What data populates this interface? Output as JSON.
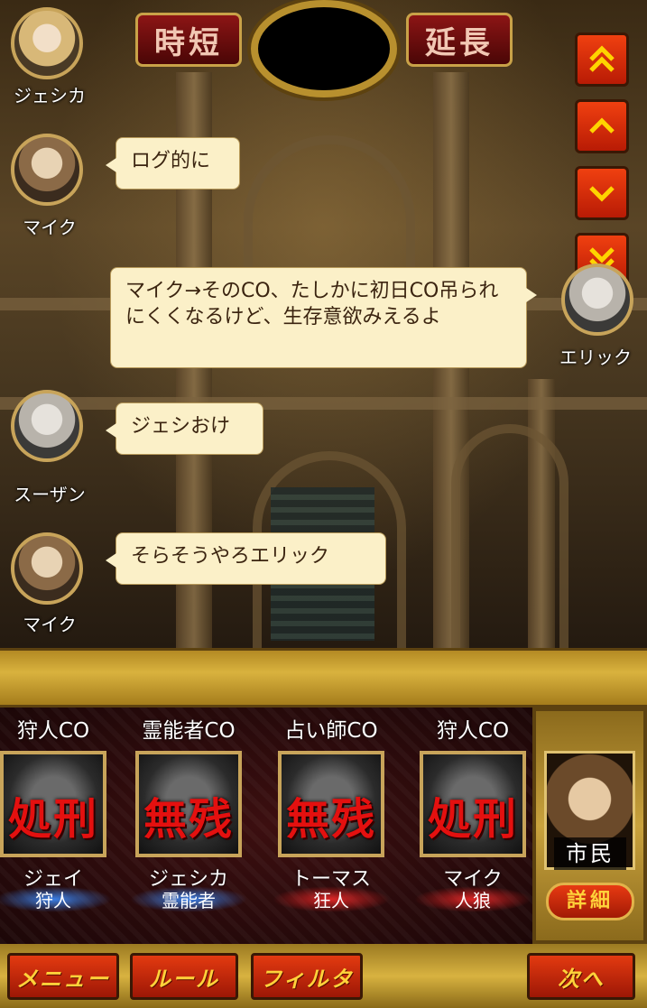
{
  "topbar": {
    "shorten_label": "時短",
    "extend_label": "延長"
  },
  "chat": {
    "messages": [
      {
        "speaker": "ジェシカ",
        "text": ""
      },
      {
        "speaker": "マイク",
        "text": "ログ的に"
      },
      {
        "speaker": "エリック",
        "text": "マイク→そのCO、たしかに初日CO吊られにくくなるけど、生存意欲みえるよ"
      },
      {
        "speaker": "スーザン",
        "text": "ジェシおけ"
      },
      {
        "speaker": "マイク",
        "text": "そらそうやろエリック"
      }
    ]
  },
  "players": [
    {
      "co": "狩人CO",
      "stamp": "処刑",
      "name": "ジェイ",
      "role": "狩人",
      "role_color": "blue"
    },
    {
      "co": "霊能者CO",
      "stamp": "無残",
      "name": "ジェシカ",
      "role": "霊能者",
      "role_color": "blue"
    },
    {
      "co": "占い師CO",
      "stamp": "無残",
      "name": "トーマス",
      "role": "狂人",
      "role_color": "red"
    },
    {
      "co": "狩人CO",
      "stamp": "処刑",
      "name": "マイク",
      "role": "人狼",
      "role_color": "red"
    }
  ],
  "self": {
    "role": "市民",
    "detail_label": "詳細"
  },
  "bottombar": {
    "menu_label": "メニュー",
    "rules_label": "ルール",
    "filter_label": "フィルタ",
    "next_label": "次へ"
  }
}
